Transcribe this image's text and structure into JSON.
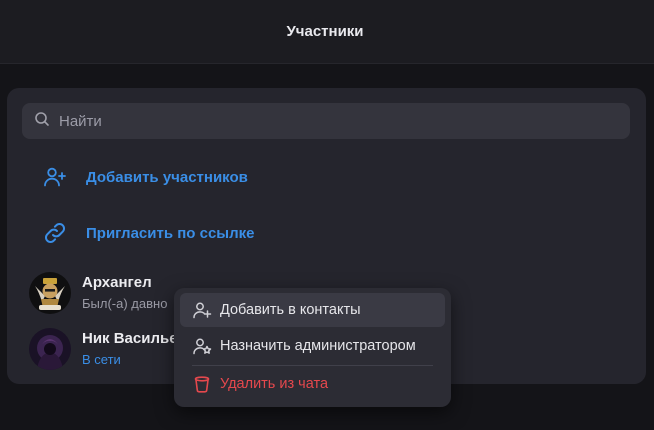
{
  "header": {
    "title": "Участники"
  },
  "search": {
    "placeholder": "Найти"
  },
  "actions": {
    "add_members": "Добавить участников",
    "invite_link": "Пригласить по ссылке"
  },
  "members": [
    {
      "name": "Архангел",
      "status": "Был(-а) давно"
    },
    {
      "name": "Ник Васильев",
      "status": "В сети"
    }
  ],
  "context_menu": {
    "add_contact": "Добавить в контакты",
    "make_admin": "Назначить администратором",
    "remove_from_chat": "Удалить из чата"
  },
  "colors": {
    "accent": "#3a8ee6",
    "danger": "#e5484d",
    "background": "#141418",
    "panel": "#25252d"
  }
}
